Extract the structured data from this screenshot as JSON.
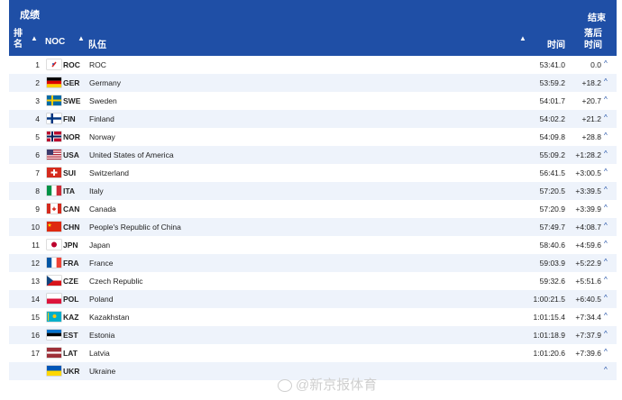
{
  "panel": {
    "title": "成绩",
    "status": "结束"
  },
  "columns": {
    "rank": "排名",
    "noc": "NOC",
    "team": "队伍",
    "time": "时间",
    "behind": "落后时间"
  },
  "rows": [
    {
      "rank": "1",
      "noc": "ROC",
      "name": "ROC",
      "time": "53:41.0",
      "behind": "0.0",
      "flag": "roc"
    },
    {
      "rank": "2",
      "noc": "GER",
      "name": "Germany",
      "time": "53:59.2",
      "behind": "+18.2",
      "flag": "ger"
    },
    {
      "rank": "3",
      "noc": "SWE",
      "name": "Sweden",
      "time": "54:01.7",
      "behind": "+20.7",
      "flag": "swe"
    },
    {
      "rank": "4",
      "noc": "FIN",
      "name": "Finland",
      "time": "54:02.2",
      "behind": "+21.2",
      "flag": "fin"
    },
    {
      "rank": "5",
      "noc": "NOR",
      "name": "Norway",
      "time": "54:09.8",
      "behind": "+28.8",
      "flag": "nor"
    },
    {
      "rank": "6",
      "noc": "USA",
      "name": "United States of America",
      "time": "55:09.2",
      "behind": "+1:28.2",
      "flag": "usa"
    },
    {
      "rank": "7",
      "noc": "SUI",
      "name": "Switzerland",
      "time": "56:41.5",
      "behind": "+3:00.5",
      "flag": "sui"
    },
    {
      "rank": "8",
      "noc": "ITA",
      "name": "Italy",
      "time": "57:20.5",
      "behind": "+3:39.5",
      "flag": "ita"
    },
    {
      "rank": "9",
      "noc": "CAN",
      "name": "Canada",
      "time": "57:20.9",
      "behind": "+3:39.9",
      "flag": "can"
    },
    {
      "rank": "10",
      "noc": "CHN",
      "name": "People's Republic of China",
      "time": "57:49.7",
      "behind": "+4:08.7",
      "flag": "chn"
    },
    {
      "rank": "11",
      "noc": "JPN",
      "name": "Japan",
      "time": "58:40.6",
      "behind": "+4:59.6",
      "flag": "jpn"
    },
    {
      "rank": "12",
      "noc": "FRA",
      "name": "France",
      "time": "59:03.9",
      "behind": "+5:22.9",
      "flag": "fra"
    },
    {
      "rank": "13",
      "noc": "CZE",
      "name": "Czech Republic",
      "time": "59:32.6",
      "behind": "+5:51.6",
      "flag": "cze"
    },
    {
      "rank": "14",
      "noc": "POL",
      "name": "Poland",
      "time": "1:00:21.5",
      "behind": "+6:40.5",
      "flag": "pol"
    },
    {
      "rank": "15",
      "noc": "KAZ",
      "name": "Kazakhstan",
      "time": "1:01:15.4",
      "behind": "+7:34.4",
      "flag": "kaz"
    },
    {
      "rank": "16",
      "noc": "EST",
      "name": "Estonia",
      "time": "1:01:18.9",
      "behind": "+7:37.9",
      "flag": "est"
    },
    {
      "rank": "17",
      "noc": "LAT",
      "name": "Latvia",
      "time": "1:01:20.6",
      "behind": "+7:39.6",
      "flag": "lat"
    },
    {
      "rank": "",
      "noc": "UKR",
      "name": "Ukraine",
      "time": "",
      "behind": "",
      "flag": "ukr"
    }
  ],
  "watermark": "@新京报体育",
  "colors": {
    "header_bg": "#1f4fa6",
    "row_alt": "#eef3fb",
    "chevron": "#1f4fa6"
  }
}
